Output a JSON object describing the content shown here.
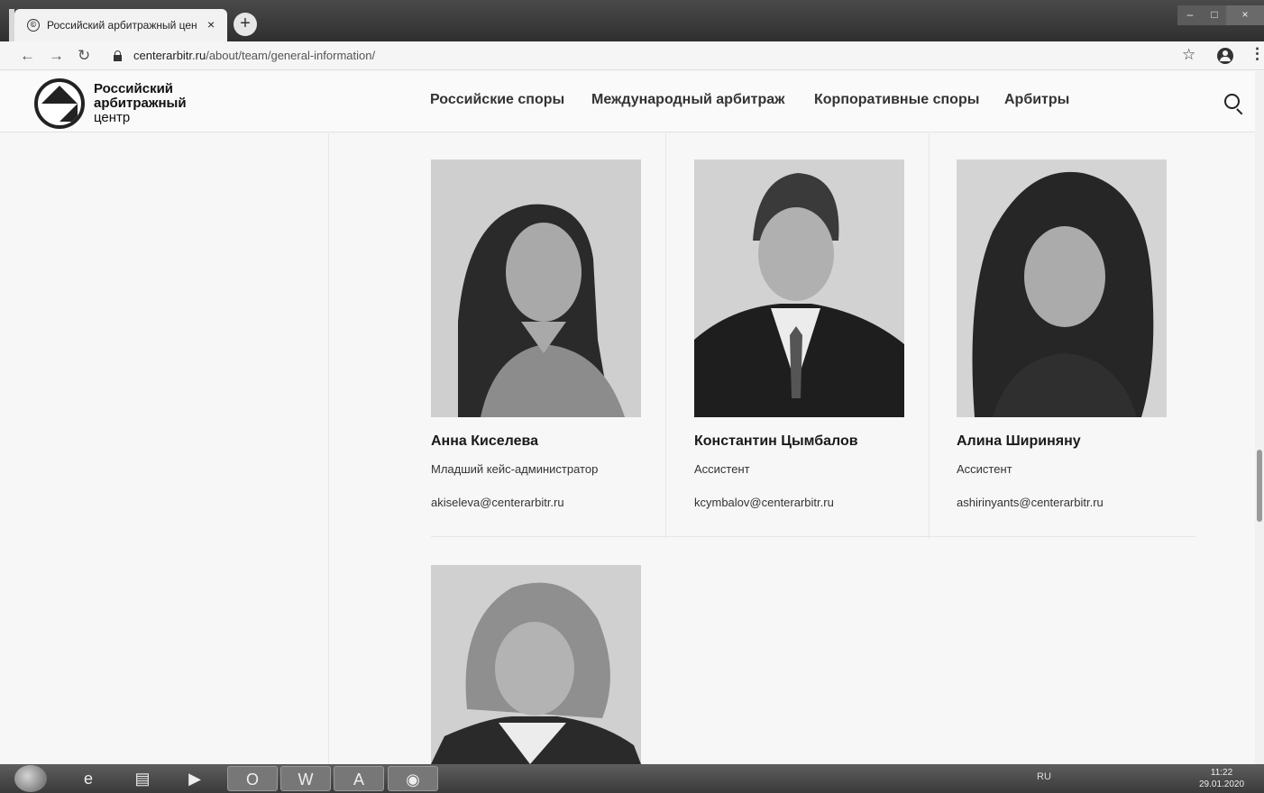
{
  "browser": {
    "tab_title": "Российский арбитражный цен",
    "tab_close": "×",
    "new_tab": "+",
    "url_host": "centerarbitr.ru",
    "url_path": "/about/team/general-information/",
    "window_min": "–",
    "window_max": "□",
    "window_close": "×"
  },
  "site": {
    "logo_line1": "Российский",
    "logo_line2": "арбитражный",
    "logo_line3": "центр",
    "nav": [
      "Российские споры",
      "Международный арбитраж",
      "Корпоративные споры",
      "Арбитры"
    ]
  },
  "team": [
    {
      "name": "Анна Киселева",
      "role": "Младший кейс-администратор",
      "email": "akiseleva@centerarbitr.ru"
    },
    {
      "name": "Константин Цымбалов",
      "role": "Ассистент",
      "email": "kcymbalov@centerarbitr.ru"
    },
    {
      "name": "Алина Шириняну",
      "role": "Ассистент",
      "email": "ashirinyants@centerarbitr.ru"
    }
  ],
  "taskbar": {
    "tray_lang": "RU",
    "clock_time": "11:22",
    "clock_date": "29.01.2020"
  }
}
